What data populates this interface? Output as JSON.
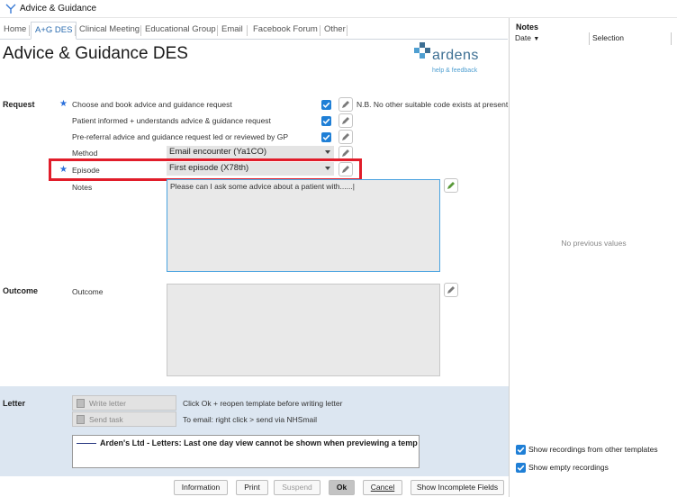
{
  "window": {
    "title": "Advice & Guidance"
  },
  "tabs": [
    "Home",
    "A+G DES",
    "Clinical Meeting",
    "Educational Group",
    "Email",
    "Facebook Forum",
    "Other"
  ],
  "active_tab": "A+G DES",
  "page_title": "Advice & Guidance DES",
  "logo": {
    "word": "ardens",
    "sub": "help & feedback"
  },
  "request": {
    "section_label": "Request",
    "items": [
      {
        "label": "Choose and book advice and guidance request",
        "checked": true,
        "note": "N.B. No other suitable code exists at present"
      },
      {
        "label": "Patient informed + understands advice & guidance request",
        "checked": true
      },
      {
        "label": "Pre-referral advice and guidance request led or reviewed by GP",
        "checked": true
      }
    ],
    "method_label": "Method",
    "method_value": "Email encounter (Ya1CO)",
    "episode_label": "Episode",
    "episode_value": "First episode (X78th)",
    "notes_label": "Notes",
    "notes_value": "Please can I ask some advice about a patient with......|"
  },
  "outcome": {
    "section_label": "Outcome",
    "field_label": "Outcome",
    "value": ""
  },
  "letter": {
    "section_label": "Letter",
    "write_letter": "Write letter",
    "write_hint": "Click Ok + reopen template before writing letter",
    "send_task": "Send task",
    "send_hint": "To email: right click > send via NHSmail",
    "preview_text": "Arden's Ltd - Letters: Last one day view cannot be shown when previewing a temp"
  },
  "buttons": {
    "information": "Information",
    "print": "Print",
    "suspend": "Suspend",
    "ok": "Ok",
    "cancel": "Cancel",
    "show_incomplete": "Show Incomplete Fields"
  },
  "notes_panel": {
    "title": "Notes",
    "col_date": "Date",
    "col_selection": "Selection",
    "empty_text": "No previous values",
    "opt_other_templates": "Show recordings from other templates",
    "opt_empty": "Show empty recordings"
  },
  "colors": {
    "accent": "#2b6cb0",
    "highlight": "#e11d2a",
    "checkbox": "#1f7fd6",
    "letter_band": "#dce6f1"
  }
}
